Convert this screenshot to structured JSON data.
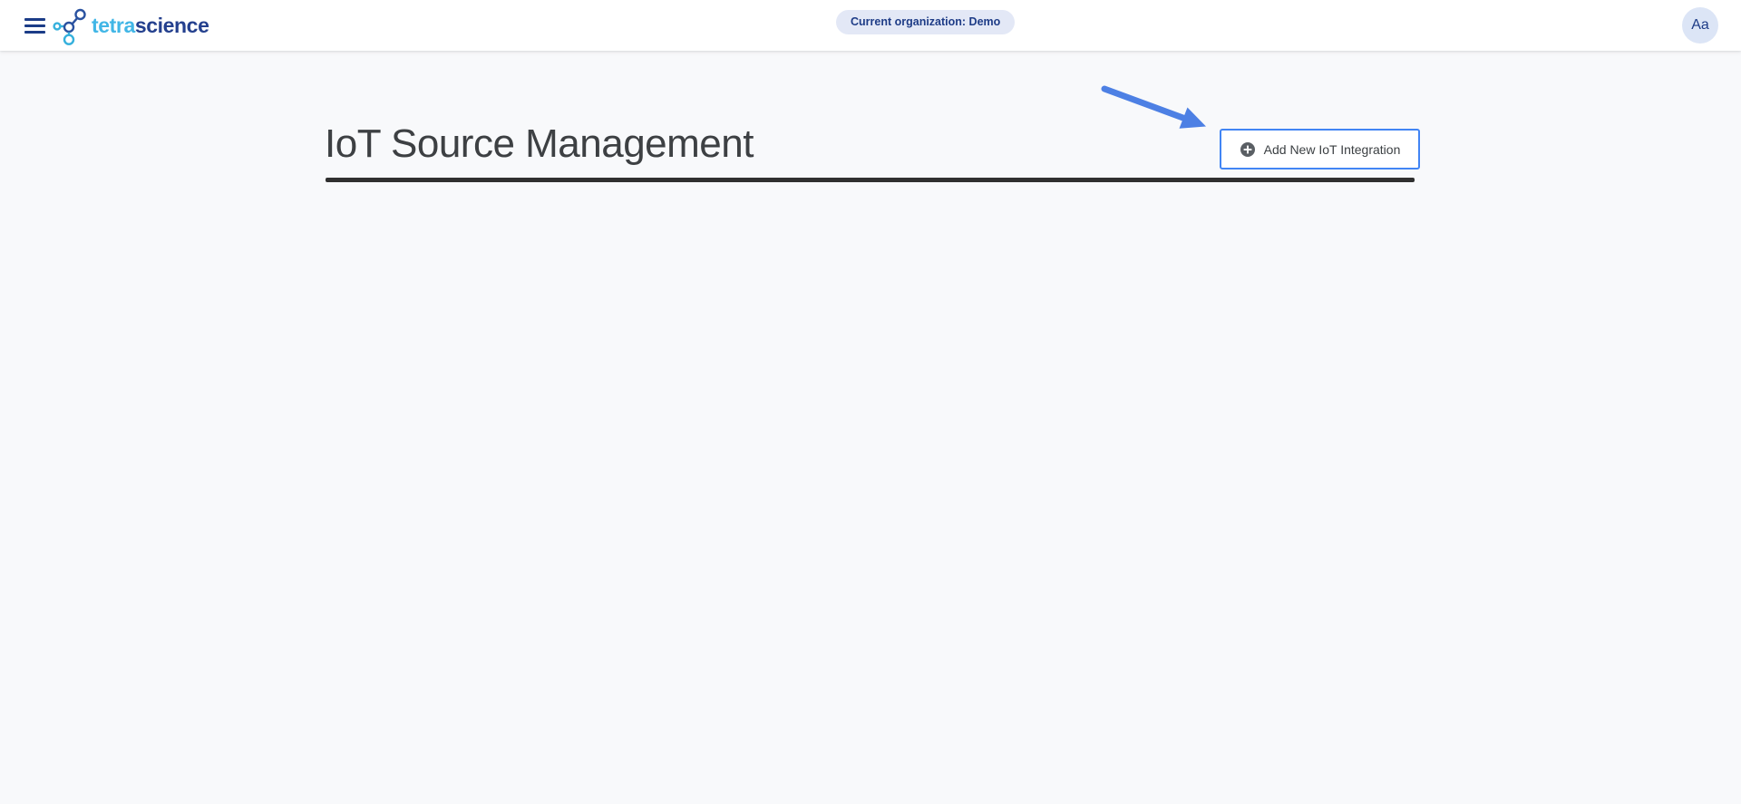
{
  "header": {
    "menu_icon": "hamburger-menu-icon",
    "logo_icon": "tetrascience-molecule-icon",
    "logo_text_primary": "tetra",
    "logo_text_secondary": "science",
    "org_badge_label": "Current organization: Demo",
    "avatar_initials": "Aa"
  },
  "main": {
    "page_title": "IoT Source Management",
    "add_integration_button_label": "Add New IoT Integration",
    "add_integration_button_icon": "plus-circle-icon",
    "annotation_icon": "arrow-annotation-pointing-to-add-button"
  },
  "colors": {
    "header_bg": "#ffffff",
    "page_bg": "#f8f9fb",
    "hamburger_navy": "#1b3c87",
    "logo_cyan": "#41b6e6",
    "logo_navy": "#24408e",
    "badge_bg": "#e3e8f6",
    "badge_text": "#1e3c87",
    "avatar_bg": "#dce5f6",
    "title_text": "#3d4043",
    "button_border_blue": "#4285f4",
    "button_text": "#3c4043",
    "plus_icon_gray": "#5a5f64",
    "annotation_arrow_blue": "#4d80e4",
    "divider_dark": "#303030"
  }
}
